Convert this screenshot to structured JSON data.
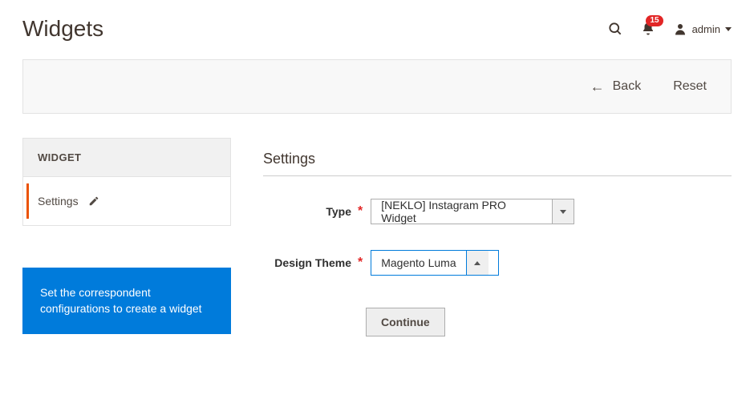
{
  "header": {
    "title": "Widgets",
    "notification_count": "15",
    "user": "admin"
  },
  "actions": {
    "back": "Back",
    "reset": "Reset"
  },
  "sidebar": {
    "section": "WIDGET",
    "item": "Settings"
  },
  "callout": "Set the correspondent configurations to create a widget",
  "form": {
    "title": "Settings",
    "type_label": "Type",
    "type_value": "[NEKLO] Instagram PRO Widget",
    "theme_label": "Design Theme",
    "theme_value": "Magento Luma",
    "continue": "Continue"
  }
}
